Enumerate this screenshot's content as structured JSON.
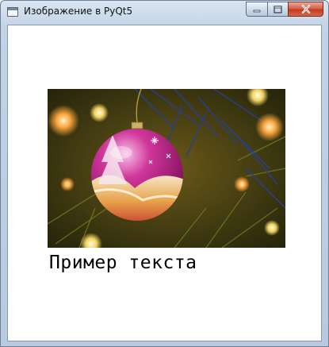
{
  "window": {
    "title": "Изображение в PyQt5",
    "app_icon": "window-icon",
    "controls": {
      "minimize_icon": "minimize-icon",
      "maximize_icon": "maximize-icon",
      "close_icon": "close-icon"
    }
  },
  "content": {
    "image_subject": "christmas-ornament-photo",
    "caption": "Пример текста"
  }
}
